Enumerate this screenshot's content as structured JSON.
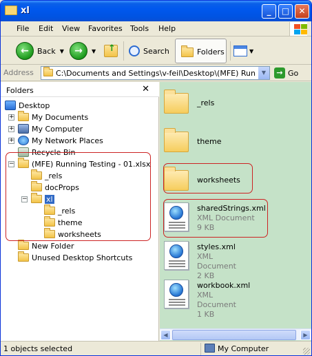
{
  "window": {
    "title": "xl"
  },
  "titlebar_buttons": {
    "minimize": "_",
    "maximize": "□",
    "close": "✕"
  },
  "menu": [
    "File",
    "Edit",
    "View",
    "Favorites",
    "Tools",
    "Help"
  ],
  "toolbar": {
    "back": "Back",
    "search": "Search",
    "folders": "Folders"
  },
  "address": {
    "label": "Address",
    "value": "C:\\Documents and Settings\\v-feil\\Desktop\\(MFE) Running Te",
    "go": "Go"
  },
  "folders_pane": {
    "header": "Folders",
    "close": "✕",
    "items": [
      "Desktop",
      "My Documents",
      "My Computer",
      "My Network Places",
      "Recycle Bin",
      "(MFE) Running Testing - 01.xlsx",
      "_rels",
      "docProps",
      "xl",
      "_rels",
      "theme",
      "worksheets",
      "New Folder",
      "Unused Desktop Shortcuts"
    ]
  },
  "content": {
    "folders": [
      "_rels",
      "theme",
      "worksheets"
    ],
    "files": [
      {
        "name": "sharedStrings.xml",
        "type": "XML Document",
        "size": "9 KB"
      },
      {
        "name": "styles.xml",
        "type": "XML Document",
        "size": "2 KB"
      },
      {
        "name": "workbook.xml",
        "type": "XML Document",
        "size": "1 KB"
      }
    ]
  },
  "status": {
    "selected": "1 objects selected",
    "zone": "My Computer"
  },
  "colors": {
    "selection": "#316ac5",
    "content_bg": "#c5e2c8",
    "annotation": "#cc2222"
  }
}
